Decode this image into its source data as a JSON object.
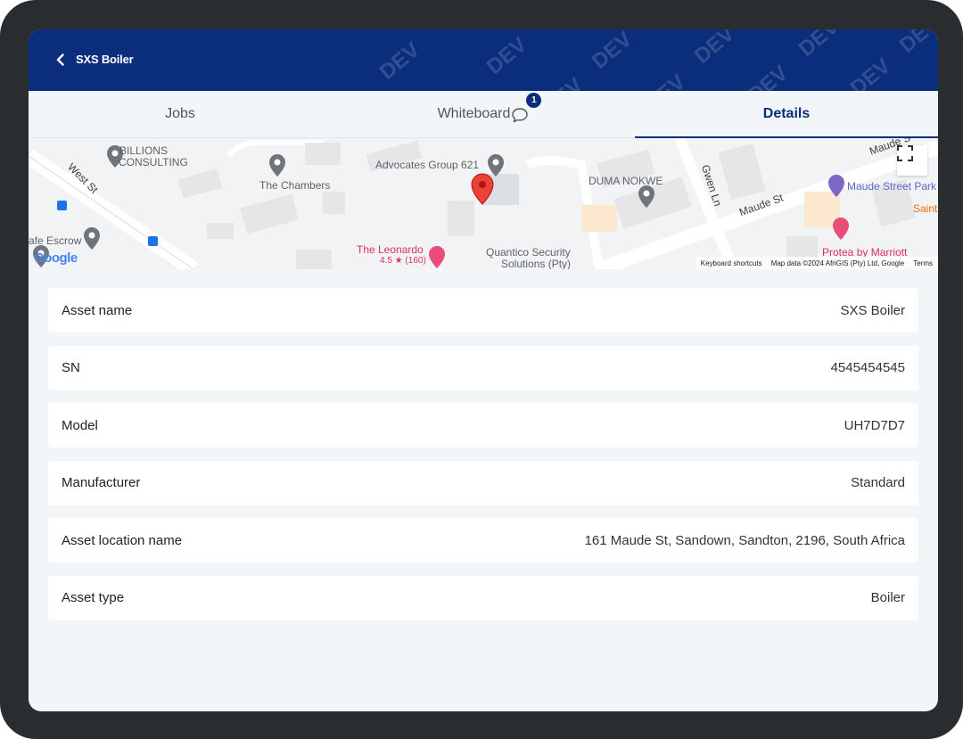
{
  "header": {
    "title": "SXS Boiler",
    "watermark": "DEV"
  },
  "tabs": [
    {
      "label": "Jobs",
      "active": false
    },
    {
      "label": "Whiteboard",
      "active": false,
      "badge": "1"
    },
    {
      "label": "Details",
      "active": true
    }
  ],
  "map": {
    "labels": {
      "billions": "BILLIONS",
      "consulting": "CONSULTING",
      "the_chambers": "The Chambers",
      "advocates": "Advocates Group 621",
      "duma": "DUMA NOKWE",
      "maude_street_park": "Maude Street Park",
      "saint": "Saint",
      "west_st": "West St",
      "gwen_ln": "Gwen Ln",
      "maude_st": "Maude St",
      "maude_st_top": "Maude S",
      "cafe_escrow": "afe Escrow",
      "the_leonardo": "The Leonardo",
      "leonardo_rating": "4.5 ★ (160)",
      "quantico_1": "Quantico Security",
      "quantico_2": "Solutions (Pty)",
      "protea": "Protea by Marriott"
    },
    "footer": {
      "shortcuts": "Keyboard shortcuts",
      "data": "Map data ©2024 AfriGIS (Pty) Ltd, Google",
      "terms": "Terms"
    },
    "google": "Google"
  },
  "details": [
    {
      "label": "Asset name",
      "value": "SXS Boiler"
    },
    {
      "label": "SN",
      "value": "4545454545"
    },
    {
      "label": "Model",
      "value": "UH7D7D7"
    },
    {
      "label": "Manufacturer",
      "value": "Standard"
    },
    {
      "label": "Asset location name",
      "value": "161 Maude St, Sandown, Sandton, 2196, South Africa"
    },
    {
      "label": "Asset type",
      "value": "Boiler"
    }
  ],
  "colors": {
    "primary": "#0a2d7c",
    "background": "#f3f6f9",
    "pin": "#ea4335"
  }
}
